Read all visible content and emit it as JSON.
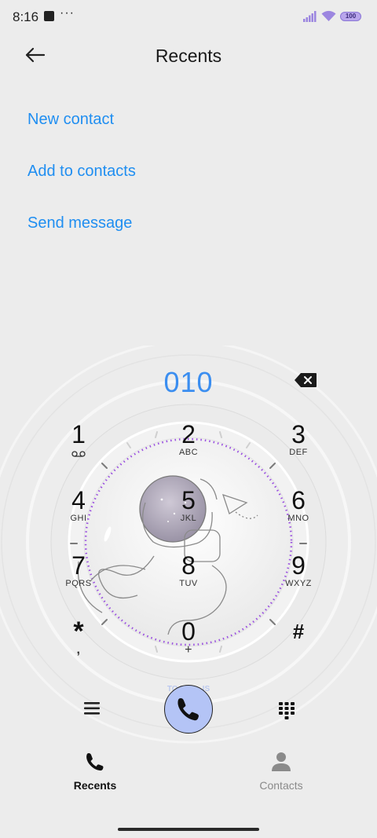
{
  "status": {
    "time": "8:16",
    "more": "···",
    "battery": "100"
  },
  "header": {
    "title": "Recents"
  },
  "actions": {
    "new_contact": "New contact",
    "add_to_contacts": "Add to contacts",
    "send_message": "Send message"
  },
  "dialer": {
    "number": "010",
    "keys": [
      {
        "digit": "1",
        "letters": ""
      },
      {
        "digit": "2",
        "letters": "ABC"
      },
      {
        "digit": "3",
        "letters": "DEF"
      },
      {
        "digit": "4",
        "letters": "GHI"
      },
      {
        "digit": "5",
        "letters": "JKL"
      },
      {
        "digit": "6",
        "letters": "MNO"
      },
      {
        "digit": "7",
        "letters": "PQRS"
      },
      {
        "digit": "8",
        "letters": "TUV"
      },
      {
        "digit": "9",
        "letters": "WXYZ"
      },
      {
        "digit": "*",
        "letters": ","
      },
      {
        "digit": "0",
        "letters": "+"
      },
      {
        "digit": "#",
        "letters": ""
      }
    ],
    "ring_text_line1": "TO THE...IS",
    "ring_text_line2": "TO...S"
  },
  "nav": {
    "recents": "Recents",
    "contacts": "Contacts"
  },
  "colors": {
    "accent": "#1f8ef1",
    "call_button": "#b4c4f6",
    "dial_ring": "#9a4fe0",
    "background": "#ececec"
  },
  "icons": [
    "back-arrow-icon",
    "backspace-icon",
    "voicemail-icon",
    "menu-icon",
    "phone-icon",
    "keypad-icon",
    "person-icon",
    "signal-icon",
    "wifi-icon"
  ]
}
